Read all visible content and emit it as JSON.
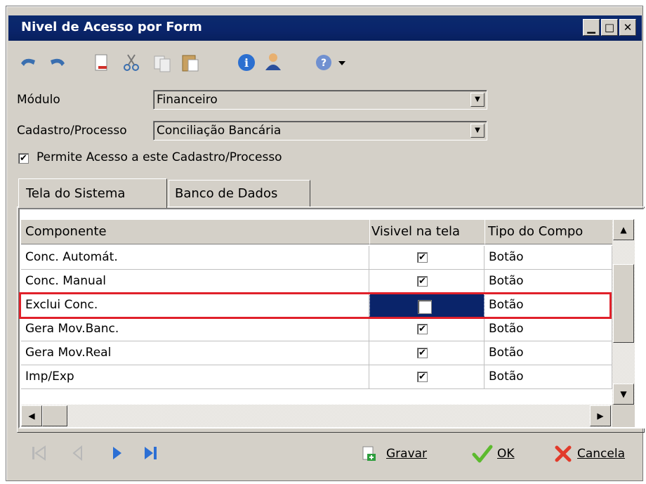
{
  "window": {
    "title": "Nivel de Acesso por Form"
  },
  "title_buttons": {
    "minimize": "_",
    "maximize": "□",
    "close": "X"
  },
  "toolbar": {
    "items": [
      "undo-icon",
      "redo-icon",
      "new-document-icon",
      "cut-icon",
      "copy-icon",
      "paste-icon",
      "info-icon",
      "user-icon",
      "help-icon",
      "dropdown-arrow-icon"
    ]
  },
  "form": {
    "modulo_label": "Módulo",
    "modulo_value": "Financeiro",
    "cadastro_label": "Cadastro/Processo",
    "cadastro_value": "Conciliação Bancária",
    "permite_label": "Permite Acesso a este Cadastro/Processo",
    "permite_checked": true
  },
  "tabs": [
    "Tela do Sistema",
    "Banco de Dados"
  ],
  "grid": {
    "columns": [
      "Componente",
      "Visivel na tela",
      "Tipo do Compo"
    ],
    "rows": [
      {
        "componente": "Conc. Automát.",
        "visivel": true,
        "tipo": "Botão"
      },
      {
        "componente": "Conc. Manual",
        "visivel": true,
        "tipo": "Botão"
      },
      {
        "componente": "Exclui Conc.",
        "visivel": false,
        "tipo": "Botão"
      },
      {
        "componente": "Gera Mov.Banc.",
        "visivel": true,
        "tipo": "Botão"
      },
      {
        "componente": "Gera Mov.Real",
        "visivel": true,
        "tipo": "Botão"
      },
      {
        "componente": "Imp/Exp",
        "visivel": true,
        "tipo": "Botão"
      }
    ],
    "selected_row": 2
  },
  "actions": {
    "gravar": "Gravar",
    "ok": "OK",
    "cancela": "Cancela"
  },
  "colors": {
    "title_bg": "#0a246a",
    "selection": "#0a246a",
    "highlight_border": "#e0202a",
    "window_bg": "#d4d0c8"
  }
}
